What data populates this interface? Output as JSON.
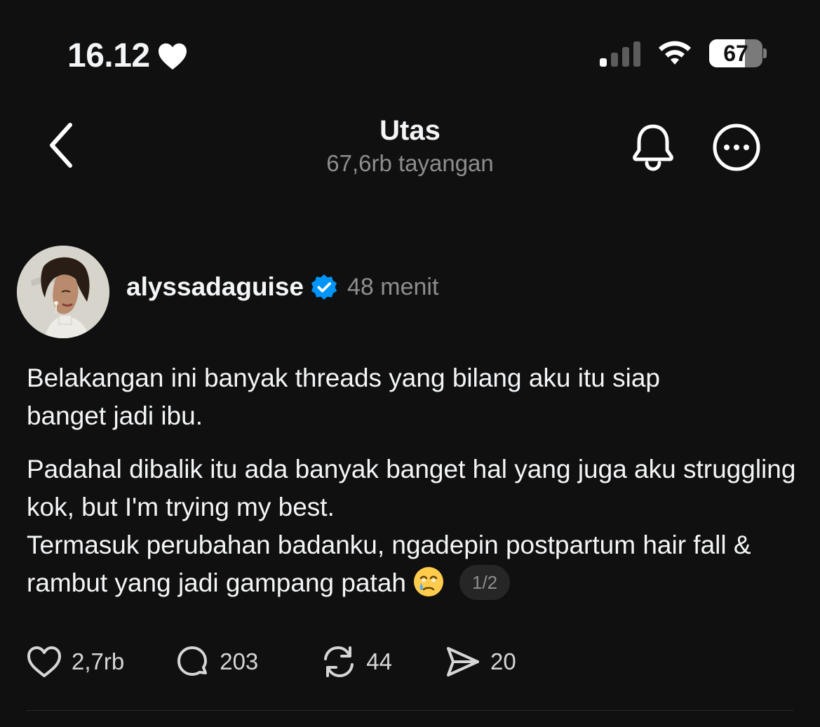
{
  "status_bar": {
    "time": "16.12",
    "battery_level": "67",
    "battery_fraction": 0.67,
    "signal_bars_active": 1,
    "signal_bars_total": 4
  },
  "header": {
    "title": "Utas",
    "views": "67,6rb tayangan"
  },
  "post": {
    "username": "alyssadaguise",
    "verified": true,
    "time_ago": "48 menit",
    "paragraph_1_line_1": "Belakangan ini banyak threads yang bilang aku itu siap",
    "paragraph_1_line_2": "banget jadi ibu.",
    "paragraph_2": "Padahal dibalik itu ada banyak banget hal yang juga aku struggling kok, but I'm trying my best.",
    "paragraph_3": "Termasuk perubahan badanku, ngadepin postpartum hair fall & rambut yang jadi gampang patah",
    "emoji_icon": "face-holding-back-tears-icon",
    "page_indicator": "1/2",
    "likes": "2,7rb",
    "replies": "203",
    "reposts": "44",
    "shares": "20"
  },
  "colors": {
    "background": "#101010",
    "text": "#f3f5f7",
    "secondary_text": "#8e8e8e",
    "verified_badge": "#0095f6"
  }
}
